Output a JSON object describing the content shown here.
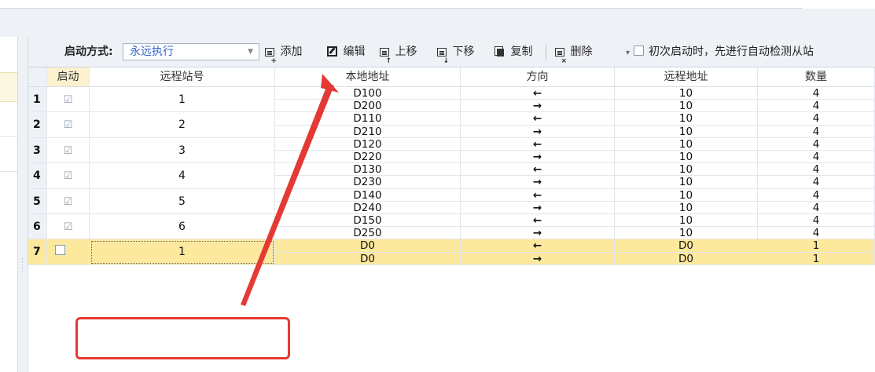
{
  "toolbar": {
    "mode_label": "启动方式:",
    "mode_value": "永远执行",
    "add_label": "添加",
    "edit_label": "编辑",
    "move_up_label": "上移",
    "move_down_label": "下移",
    "copy_label": "复制",
    "delete_label": "删除",
    "auto_detect_label": "初次启动时，先进行自动检测从站",
    "auto_detect_checked": false
  },
  "columns": [
    "启动",
    "远程站号",
    "本地地址",
    "方向",
    "远程地址",
    "数量"
  ],
  "rows": [
    {
      "num": "1",
      "enabled": true,
      "station": "1",
      "sub": [
        {
          "local": "D100",
          "dir": "←",
          "remote": "10",
          "qty": "4"
        },
        {
          "local": "D200",
          "dir": "→",
          "remote": "10",
          "qty": "4"
        }
      ]
    },
    {
      "num": "2",
      "enabled": true,
      "station": "2",
      "sub": [
        {
          "local": "D110",
          "dir": "←",
          "remote": "10",
          "qty": "4"
        },
        {
          "local": "D210",
          "dir": "→",
          "remote": "10",
          "qty": "4"
        }
      ]
    },
    {
      "num": "3",
      "enabled": true,
      "station": "3",
      "sub": [
        {
          "local": "D120",
          "dir": "←",
          "remote": "10",
          "qty": "4"
        },
        {
          "local": "D220",
          "dir": "→",
          "remote": "10",
          "qty": "4"
        }
      ]
    },
    {
      "num": "4",
      "enabled": true,
      "station": "4",
      "sub": [
        {
          "local": "D130",
          "dir": "←",
          "remote": "10",
          "qty": "4"
        },
        {
          "local": "D230",
          "dir": "→",
          "remote": "10",
          "qty": "4"
        }
      ]
    },
    {
      "num": "5",
      "enabled": true,
      "station": "5",
      "sub": [
        {
          "local": "D140",
          "dir": "←",
          "remote": "10",
          "qty": "4"
        },
        {
          "local": "D240",
          "dir": "→",
          "remote": "10",
          "qty": "4"
        }
      ]
    },
    {
      "num": "6",
      "enabled": true,
      "station": "6",
      "sub": [
        {
          "local": "D150",
          "dir": "←",
          "remote": "10",
          "qty": "4"
        },
        {
          "local": "D250",
          "dir": "→",
          "remote": "10",
          "qty": "4"
        }
      ]
    },
    {
      "num": "7",
      "enabled": false,
      "station": "1",
      "selected": true,
      "sub": [
        {
          "local": "D0",
          "dir": "←",
          "remote": "D0",
          "qty": "1"
        },
        {
          "local": "D0",
          "dir": "→",
          "remote": "D0",
          "qty": "1"
        }
      ]
    }
  ],
  "colors": {
    "accent_select_text": "#3a66c8",
    "selected_row": "#fde99e",
    "annotation_red": "#e53935"
  }
}
